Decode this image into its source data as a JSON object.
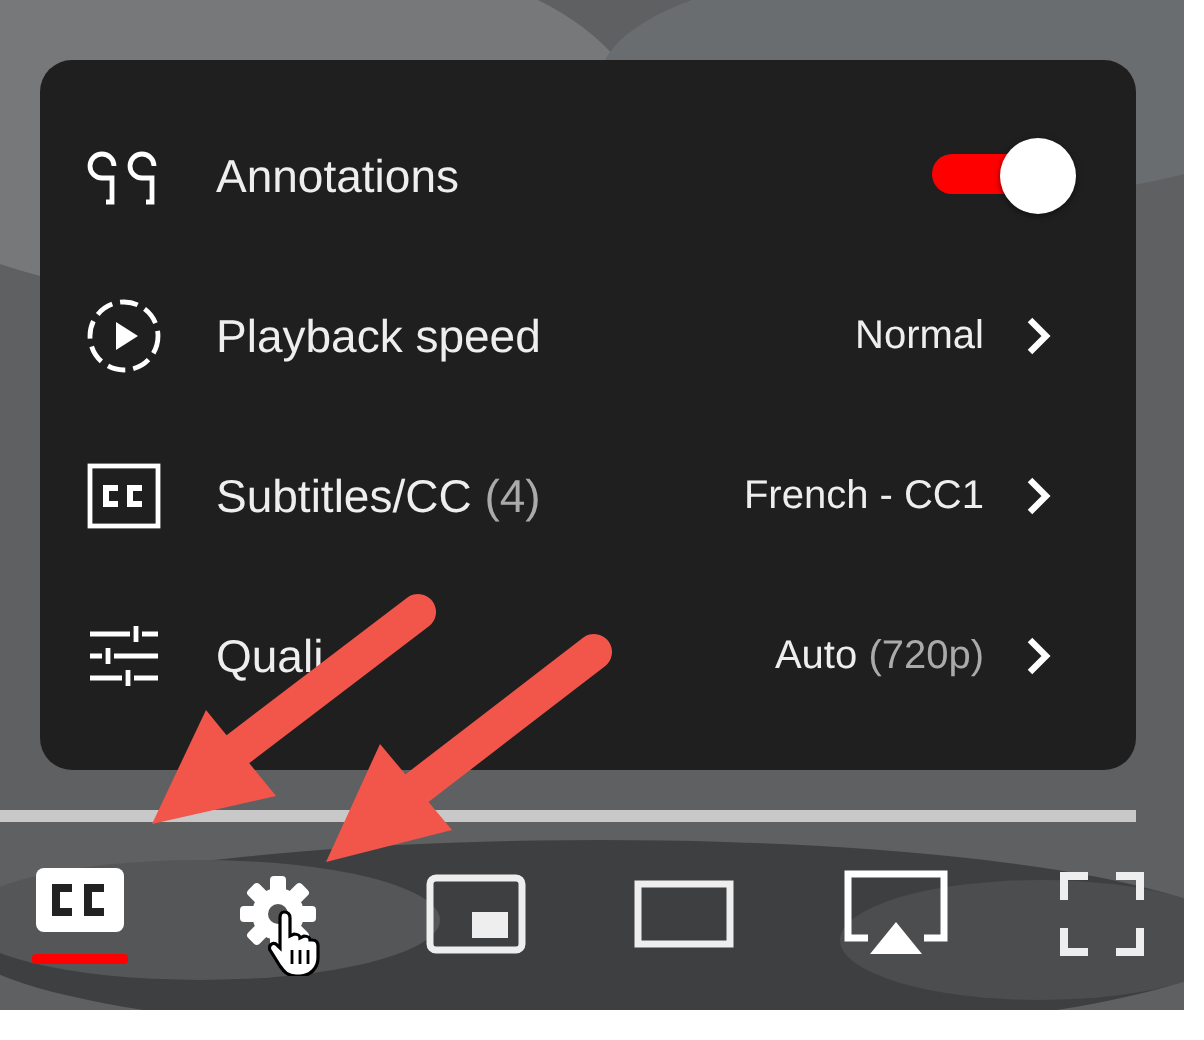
{
  "menu": {
    "items": [
      {
        "kind": "toggle",
        "label": "Annotations",
        "on": true
      },
      {
        "kind": "submenu",
        "label": "Playback speed",
        "value": "Normal"
      },
      {
        "kind": "submenu",
        "label": "Subtitles/CC",
        "count": "(4)",
        "value": "French - CC1"
      },
      {
        "kind": "submenu",
        "label": "Quali",
        "value": "Auto",
        "value_detail": "(720p)"
      }
    ]
  },
  "controls": [
    {
      "kind": "subtitles",
      "on": true
    },
    {
      "kind": "settings"
    },
    {
      "kind": "miniplayer"
    },
    {
      "kind": "theater"
    },
    {
      "kind": "airplay"
    },
    {
      "kind": "fullscreen"
    }
  ]
}
